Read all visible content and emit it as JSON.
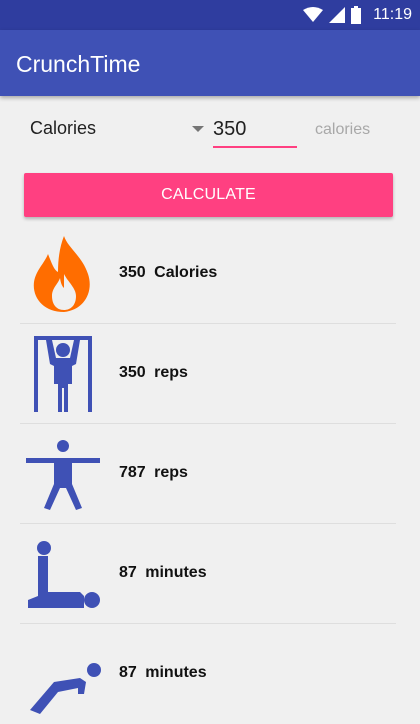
{
  "status_bar": {
    "time": "11:19"
  },
  "app_bar": {
    "title": "CrunchTime"
  },
  "form": {
    "spinner_value": "Calories",
    "amount_value": "350",
    "unit_label": "calories"
  },
  "calculate_label": "CALCULATE",
  "results": [
    {
      "icon": "fire-icon",
      "value": "350",
      "unit": "Calories"
    },
    {
      "icon": "pullup-icon",
      "value": "350",
      "unit": "reps"
    },
    {
      "icon": "jumping-jack-icon",
      "value": "787",
      "unit": "reps"
    },
    {
      "icon": "situp-icon",
      "value": "87",
      "unit": "minutes"
    },
    {
      "icon": "pushup-icon",
      "value": "87",
      "unit": "minutes"
    }
  ],
  "colors": {
    "primary": "#3f51b5",
    "primary_dark": "#2f3d9f",
    "accent": "#ff4081",
    "icon_blue": "#3f51b5",
    "fire_orange": "#ff6d00"
  }
}
